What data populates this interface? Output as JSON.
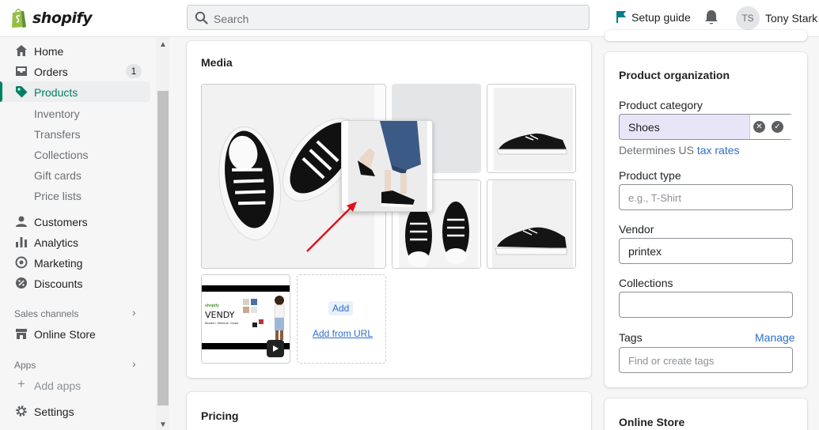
{
  "topbar": {
    "logo_text": "shopify",
    "search_placeholder": "Search",
    "setup_guide": "Setup guide",
    "avatar_initials": "TS",
    "user_name": "Tony Stark"
  },
  "sidebar": {
    "items": [
      {
        "label": "Home",
        "icon": "home-icon"
      },
      {
        "label": "Orders",
        "icon": "orders-icon",
        "badge": "1"
      },
      {
        "label": "Products",
        "icon": "tag-icon",
        "active": true
      },
      {
        "label": "Customers",
        "icon": "person-icon"
      },
      {
        "label": "Analytics",
        "icon": "bar-chart-icon"
      },
      {
        "label": "Marketing",
        "icon": "target-icon"
      },
      {
        "label": "Discounts",
        "icon": "discount-icon"
      }
    ],
    "product_subitems": [
      "Inventory",
      "Transfers",
      "Collections",
      "Gift cards",
      "Price lists"
    ],
    "sales_channels_title": "Sales channels",
    "online_store": "Online Store",
    "apps_title": "Apps",
    "add_apps": "Add apps",
    "settings": "Settings"
  },
  "media": {
    "title": "Media",
    "add_label": "Add",
    "add_from_url": "Add from URL",
    "video_thumb": {
      "brand": "shopify",
      "title": "VENDY",
      "subtitle": "Modern. Minimal. Clean."
    }
  },
  "pricing": {
    "title": "Pricing"
  },
  "organization": {
    "title": "Product organization",
    "category_label": "Product category",
    "category_value": "Shoes",
    "category_help_prefix": "Determines US ",
    "category_help_link": "tax rates",
    "type_label": "Product type",
    "type_placeholder": "e.g., T-Shirt",
    "vendor_label": "Vendor",
    "vendor_value": "printex",
    "collections_label": "Collections",
    "collections_value": "",
    "tags_label": "Tags",
    "tags_manage": "Manage",
    "tags_placeholder": "Find or create tags"
  },
  "online_store_card": {
    "title": "Online Store"
  },
  "colors": {
    "accent_green": "#008060",
    "link_blue": "#2c6ecb",
    "category_bg": "#e9e5f9",
    "annotation_red": "#e0131a"
  }
}
